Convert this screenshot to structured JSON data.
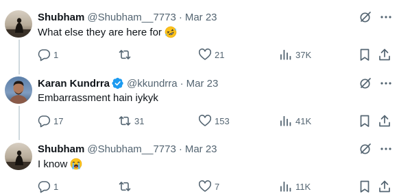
{
  "tweets": [
    {
      "name": "Shubham",
      "verified": false,
      "handle": "@Shubham__7773",
      "separator": "·",
      "date": "Mar 23",
      "text": "What else they are here for",
      "emoji": "rolling-on-floor-laughing-emoji",
      "actions": {
        "replies": "1",
        "reposts": "",
        "likes": "21",
        "views": "37K"
      }
    },
    {
      "name": "Karan Kundrra",
      "verified": true,
      "handle": "@kkundrra",
      "separator": "·",
      "date": "Mar 23",
      "text": "Embarrassment hain iykyk",
      "emoji": "",
      "actions": {
        "replies": "17",
        "reposts": "31",
        "likes": "153",
        "views": "41K"
      }
    },
    {
      "name": "Shubham",
      "verified": false,
      "handle": "@Shubham__7773",
      "separator": "·",
      "date": "Mar 23",
      "text": "I know",
      "emoji": "loudly-crying-face-emoji",
      "actions": {
        "replies": "1",
        "reposts": "",
        "likes": "7",
        "views": "11K"
      }
    }
  ],
  "colors": {
    "text": "#0f1419",
    "secondary": "#536471",
    "verified": "#1d9bf0",
    "thread_line": "#cfd9de"
  }
}
